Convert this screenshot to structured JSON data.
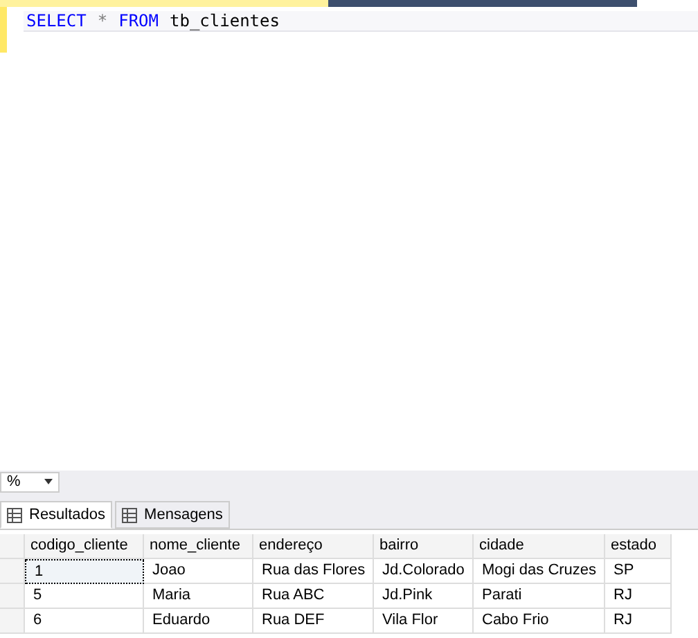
{
  "query_tokens": [
    {
      "text": "SELECT",
      "kind": "keyword"
    },
    {
      "text": "*",
      "kind": "operator"
    },
    {
      "text": "FROM",
      "kind": "keyword"
    },
    {
      "text": "tb_clientes",
      "kind": "identifier"
    }
  ],
  "zoom": {
    "value": "%"
  },
  "tabs": [
    {
      "label": "Resultados",
      "selected": true
    },
    {
      "label": "Mensagens",
      "selected": false
    }
  ],
  "table": {
    "columns": [
      "codigo_cliente",
      "nome_cliente",
      "endereço",
      "bairro",
      "cidade",
      "estado"
    ],
    "rows": [
      {
        "cells": [
          "1",
          "Joao",
          "Rua das Flores",
          "Jd.Colorado",
          "Mogi das Cruzes",
          "SP"
        ],
        "selected": true
      },
      {
        "cells": [
          "5",
          "Maria",
          "Rua ABC",
          "Jd.Pink",
          "Parati",
          "RJ"
        ],
        "selected": false
      },
      {
        "cells": [
          "6",
          "Eduardo",
          "Rua DEF",
          "Vila Flor",
          "Cabo Frio",
          "RJ"
        ],
        "selected": false
      }
    ]
  }
}
